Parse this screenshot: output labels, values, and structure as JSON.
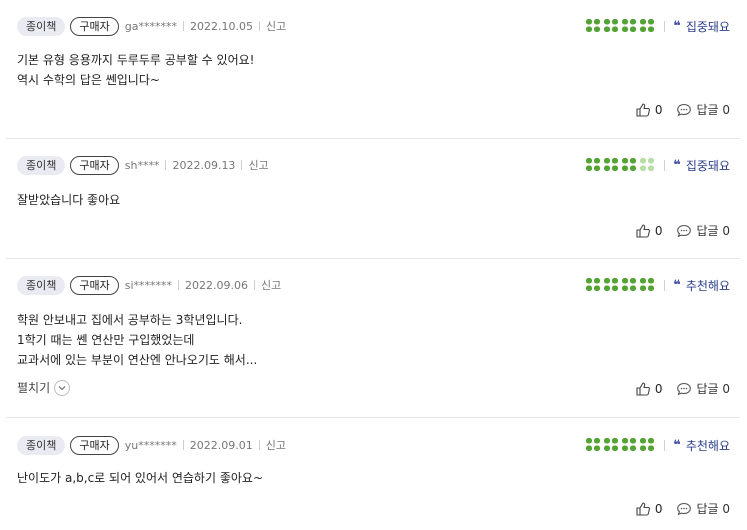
{
  "reviews": [
    {
      "type_badge": "종이책",
      "buyer_badge": "구매자",
      "user": "ga*******",
      "date": "2022.10.05",
      "report": "신고",
      "rating_filled": 4,
      "rating_label": "집중돼요",
      "lines": [
        "기본 유형 응용까지 두루두루 공부할 수 있어요!",
        "역시 수학의 답은 쎈입니다~"
      ],
      "likes": "0",
      "reply_label": "답글 0"
    },
    {
      "type_badge": "종이책",
      "buyer_badge": "구매자",
      "user": "sh****",
      "date": "2022.09.13",
      "report": "신고",
      "rating_filled": 3,
      "rating_label": "집중돼요",
      "lines": [
        "잘받았습니다 좋아요"
      ],
      "likes": "0",
      "reply_label": "답글 0"
    },
    {
      "type_badge": "종이책",
      "buyer_badge": "구매자",
      "user": "si*******",
      "date": "2022.09.06",
      "report": "신고",
      "rating_filled": 4,
      "rating_label": "추천해요",
      "lines": [
        "학원 안보내고 집에서 공부하는 3학년입니다.",
        "1학기 때는 쎈 연산만 구입했었는데",
        "교과서에 있는 부분이 연산엔 안나오기도 해서..."
      ],
      "more_label": "펼치기",
      "likes": "0",
      "reply_label": "답글 0"
    },
    {
      "type_badge": "종이책",
      "buyer_badge": "구매자",
      "user": "yu*******",
      "date": "2022.09.01",
      "report": "신고",
      "rating_filled": 4,
      "rating_label": "추천해요",
      "lines": [
        "난이도가 a,b,c로 되어 있어서 연습하기 좋아요~"
      ],
      "likes": "0",
      "reply_label": "답글 0"
    }
  ],
  "colors": {
    "clover_filled": "#53a434",
    "clover_empty": "#b6dea5",
    "rating_label": "#2c3e8c"
  },
  "icons": {
    "rating": "clover-icon",
    "quote": "quote-icon",
    "like": "thumbs-up-icon",
    "reply": "speech-bubble-icon",
    "expand": "chevron-down-icon"
  }
}
